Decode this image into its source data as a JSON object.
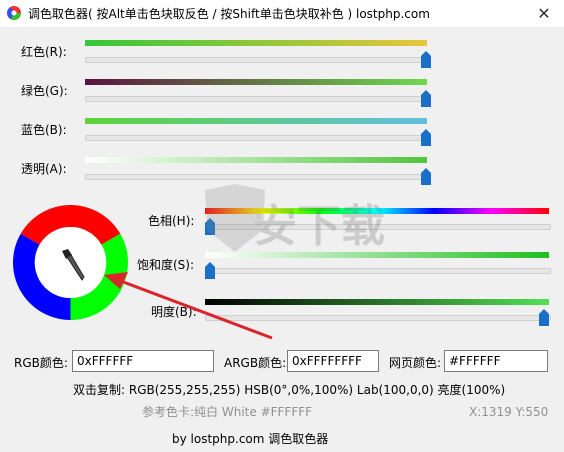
{
  "window": {
    "title": "调色取色器( 按Alt单击色块取反色 / 按Shift单击色块取补色 ) lostphp.com",
    "close_glyph": "✕"
  },
  "rgba_sliders": [
    {
      "label": "红色(R):",
      "value": 255,
      "gradient_start": "#35c63a",
      "gradient_end": "#e8c63c"
    },
    {
      "label": "绿色(G):",
      "value": 255,
      "gradient_start": "#5a1440",
      "gradient_end": "#6ed94e"
    },
    {
      "label": "蓝色(B):",
      "value": 255,
      "gradient_start": "#5ed33a",
      "gradient_end": "#62bde0"
    },
    {
      "label": "透明(A):",
      "value": 255,
      "gradient_start": "#ffffff",
      "gradient_end": "#4fc53c"
    }
  ],
  "hsb_sliders": [
    {
      "label": "色相(H):",
      "value": 0,
      "max": 360
    },
    {
      "label": "饱和度(S):",
      "value": 0,
      "max": 100
    },
    {
      "label": "明度(B):",
      "value": 100,
      "max": 100
    }
  ],
  "fields": {
    "rgb_label": "RGB颜色:",
    "rgb_value": "0xFFFFFF",
    "argb_label": "ARGB颜色:",
    "argb_value": "0xFFFFFFFF",
    "web_label": "网页颜色:",
    "web_value": "#FFFFFF"
  },
  "info": {
    "copy_line": "双击复制: RGB(255,255,255) HSB(0°,0%,100%) Lab(100,0,0) 亮度(100%)",
    "reference": "参考色卡:纯白 White #FFFFFF",
    "coords": "X:1319 Y:550",
    "footer": "by lostphp.com 调色取色器"
  },
  "colors": {
    "thumb": "#1a6fc9",
    "arrow": "#d8262a",
    "wheel_red": "#ff0000",
    "wheel_green": "#00ff00",
    "wheel_blue": "#0000ff"
  },
  "icons": {
    "title": "color-wheel-icon",
    "close": "close-icon",
    "picker": "eyedropper-icon"
  },
  "watermark_text": "安下载"
}
